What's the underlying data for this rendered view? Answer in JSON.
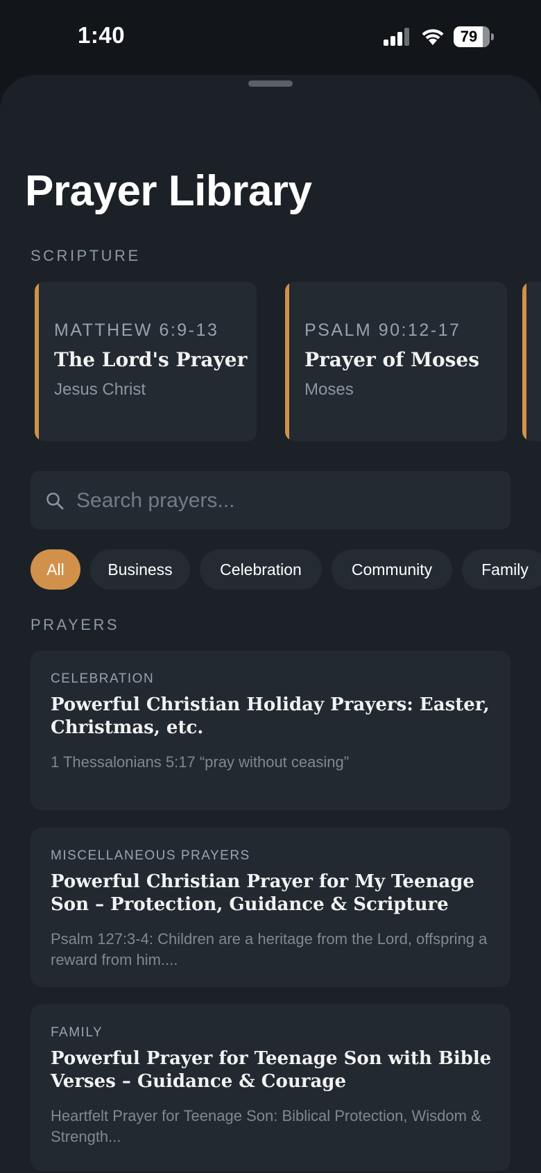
{
  "status_bar": {
    "time": "1:40",
    "battery": "79",
    "icons": [
      "signal-icon",
      "wifi-icon",
      "battery-icon"
    ]
  },
  "header": {
    "title": "Prayer Library"
  },
  "scripture": {
    "label": "SCRIPTURE",
    "cards": [
      {
        "reference": "MATTHEW 6:9-13",
        "title": "The Lord's Prayer",
        "author": "Jesus Christ"
      },
      {
        "reference": "PSALM 90:12-17",
        "title": "Prayer of Moses",
        "author": "Moses"
      }
    ]
  },
  "search": {
    "placeholder": "Search prayers...",
    "value": ""
  },
  "filters": {
    "chips": [
      "All",
      "Business",
      "Celebration",
      "Community",
      "Family"
    ],
    "selected": "All"
  },
  "prayers": {
    "label": "PRAYERS",
    "items": [
      {
        "category": "CELEBRATION",
        "title": "Powerful Christian Holiday Prayers: Easter, Christmas, etc.",
        "snippet": "1 Thessalonians 5:17 “pray without ceasing”"
      },
      {
        "category": "MISCELLANEOUS PRAYERS",
        "title": "Powerful Christian Prayer for My Teenage Son – Protection, Guidance & Scripture",
        "snippet": "Psalm 127:3-4: Children are a heritage from the Lord, offspring a reward from him...."
      },
      {
        "category": "FAMILY",
        "title": "Powerful Prayer for Teenage Son with Bible Verses – Guidance & Courage",
        "snippet": "Heartfelt Prayer for Teenage Son: Biblical Protection, Wisdom & Strength..."
      }
    ]
  },
  "colors": {
    "accent": "#d2914a",
    "sheet_background": "#1c2128",
    "card_background": "#222930"
  }
}
